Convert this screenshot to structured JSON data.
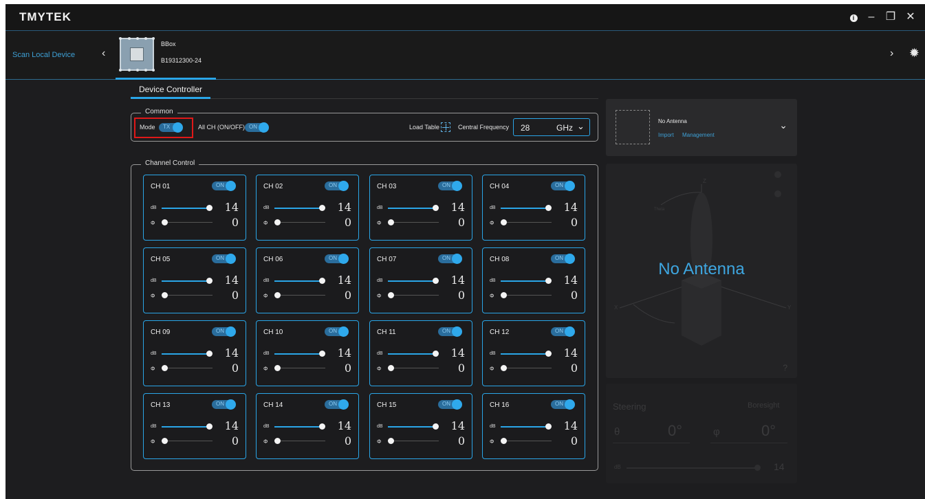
{
  "titlebar": {
    "logo": "TMYTEK",
    "info_icon": "i",
    "minimize_icon": "–",
    "restore_icon": "❐",
    "close_icon": "✕"
  },
  "devicebar": {
    "scan_label": "Scan Local Device",
    "prev_icon": "‹",
    "next_icon": "›",
    "gear_icon": "✹",
    "device": {
      "name": "BBox",
      "serial": "B19312300-24"
    }
  },
  "tabs": [
    {
      "label": "Device Controller"
    }
  ],
  "common": {
    "legend": "Common",
    "mode_label": "Mode",
    "mode_value": "TX",
    "all_ch_label": "All CH (ON/OFF)",
    "all_ch_value": "ON",
    "load_table_label": "Load Table",
    "central_freq_label": "Central Frequency",
    "central_freq_value": "28",
    "central_freq_unit": "GHz",
    "freq_chevron": "⌄"
  },
  "channel_control": {
    "legend": "Channel Control",
    "db_label": "dB",
    "phase_label": "Φ",
    "toggle_text": "ON",
    "channels": [
      {
        "name": "CH 01",
        "on": "ON",
        "db": "14",
        "phase": "0"
      },
      {
        "name": "CH 02",
        "on": "ON",
        "db": "14",
        "phase": "0"
      },
      {
        "name": "CH 03",
        "on": "ON",
        "db": "14",
        "phase": "0"
      },
      {
        "name": "CH 04",
        "on": "ON",
        "db": "14",
        "phase": "0"
      },
      {
        "name": "CH 05",
        "on": "ON",
        "db": "14",
        "phase": "0"
      },
      {
        "name": "CH 06",
        "on": "ON",
        "db": "14",
        "phase": "0"
      },
      {
        "name": "CH 07",
        "on": "ON",
        "db": "14",
        "phase": "0"
      },
      {
        "name": "CH 08",
        "on": "ON",
        "db": "14",
        "phase": "0"
      },
      {
        "name": "CH 09",
        "on": "ON",
        "db": "14",
        "phase": "0"
      },
      {
        "name": "CH 10",
        "on": "ON",
        "db": "14",
        "phase": "0"
      },
      {
        "name": "CH 11",
        "on": "ON",
        "db": "14",
        "phase": "0"
      },
      {
        "name": "CH 12",
        "on": "ON",
        "db": "14",
        "phase": "0"
      },
      {
        "name": "CH 13",
        "on": "ON",
        "db": "14",
        "phase": "0"
      },
      {
        "name": "CH 14",
        "on": "ON",
        "db": "14",
        "phase": "0"
      },
      {
        "name": "CH 15",
        "on": "ON",
        "db": "14",
        "phase": "0"
      },
      {
        "name": "CH 16",
        "on": "ON",
        "db": "14",
        "phase": "0"
      }
    ]
  },
  "antenna": {
    "title": "No Antenna",
    "import_label": "Import",
    "management_label": "Management",
    "chevron": "⌄"
  },
  "viz": {
    "overlay_text": "No Antenna",
    "help_icon": "?",
    "axis_z": "Z",
    "axis_x": "X",
    "axis_y": "Y",
    "theta_label": "Theta"
  },
  "steering": {
    "title": "Steering",
    "boresight_label": "Boresight",
    "theta_label": "θ",
    "phi_label": "φ",
    "theta_value": "0°",
    "phi_value": "0°",
    "db_label": "dB",
    "db_value": "14"
  },
  "colors": {
    "accent": "#2aa6e8",
    "highlight": "#e01818",
    "background": "#1d1d1f"
  }
}
